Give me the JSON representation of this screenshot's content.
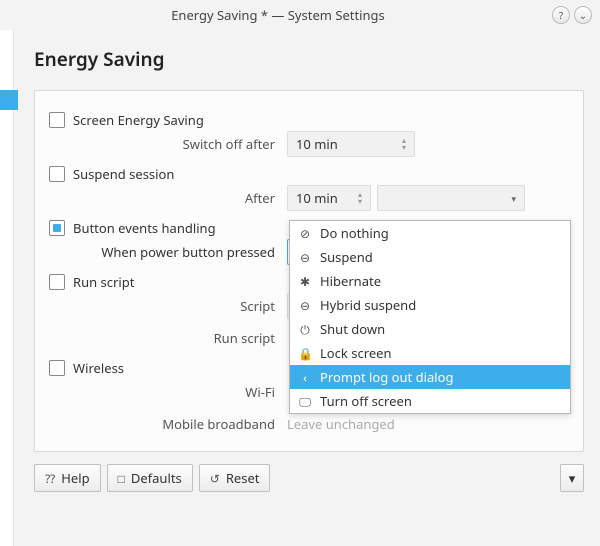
{
  "window": {
    "title": "Energy Saving * — System Settings"
  },
  "page": {
    "heading": "Energy Saving"
  },
  "screenEnergy": {
    "label": "Screen Energy Saving",
    "checked": false,
    "switchOffLabel": "Switch off after",
    "switchOffValue": "10 min"
  },
  "suspend": {
    "label": "Suspend session",
    "checked": false,
    "afterLabel": "After",
    "afterValue": "10 min"
  },
  "buttonEvents": {
    "label": "Button events handling",
    "checked": true,
    "whenLabel": "When power button pressed",
    "selected": "Do nothing"
  },
  "runScript": {
    "label": "Run script",
    "checked": false,
    "scriptLabel": "Script",
    "runLabel": "Run script"
  },
  "wireless": {
    "label": "Wireless",
    "checked": false,
    "wifiLabel": "Wi-Fi",
    "broadbandLabel": "Mobile broadband",
    "broadbandValue": "Leave unchanged"
  },
  "dropdown": {
    "items": [
      {
        "icon": "⊘",
        "label": "Do nothing"
      },
      {
        "icon": "⊖",
        "label": "Suspend"
      },
      {
        "icon": "✱",
        "label": "Hibernate"
      },
      {
        "icon": "⊖",
        "label": "Hybrid suspend"
      },
      {
        "icon": "⏻",
        "label": "Shut down"
      },
      {
        "icon": "🔒",
        "label": "Lock screen"
      },
      {
        "icon": "‹",
        "label": "Prompt log out dialog",
        "selected": true
      },
      {
        "icon": "🖵",
        "label": "Turn off screen"
      }
    ]
  },
  "buttons": {
    "help": "Help",
    "defaults": "Defaults",
    "reset": "Reset"
  }
}
